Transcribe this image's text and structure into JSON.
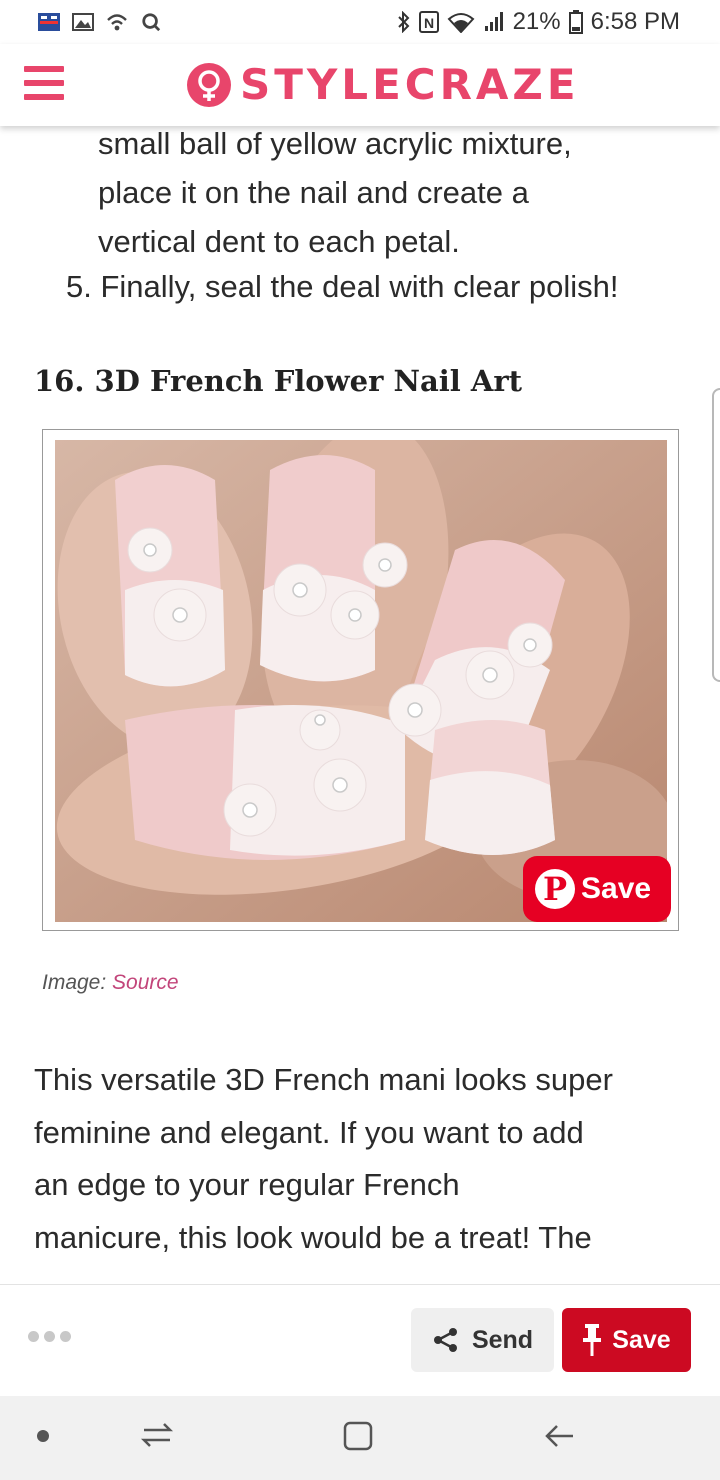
{
  "status_bar": {
    "battery": "21%",
    "time": "6:58 PM",
    "icons": [
      "notification-app-icon",
      "gallery-icon",
      "wifi-call-icon",
      "search-app-icon",
      "bluetooth-icon",
      "nfc-icon",
      "wifi-icon",
      "signal-icon",
      "battery-icon"
    ]
  },
  "header": {
    "brand": "STYLECRAZE",
    "brand_color": "#e8456b"
  },
  "article": {
    "step4_lines": [
      "small ball of yellow acrylic mixture,",
      "place it on the nail and create a",
      "vertical dent to each petal."
    ],
    "step5": "5. Finally, seal the deal with clear polish!",
    "section_title": "16. 3D French Flower Nail Art",
    "pin_save_label": "Save",
    "caption_prefix": "Image: ",
    "caption_link": "Source",
    "body_lines": [
      "This versatile 3D French mani looks super",
      "feminine and elegant. If you want to add",
      "an edge to your regular French",
      "manicure, this look would be a treat! The"
    ]
  },
  "share_bar": {
    "send_label": "Send",
    "save_label": "Save",
    "save_color": "#cc0a22"
  }
}
